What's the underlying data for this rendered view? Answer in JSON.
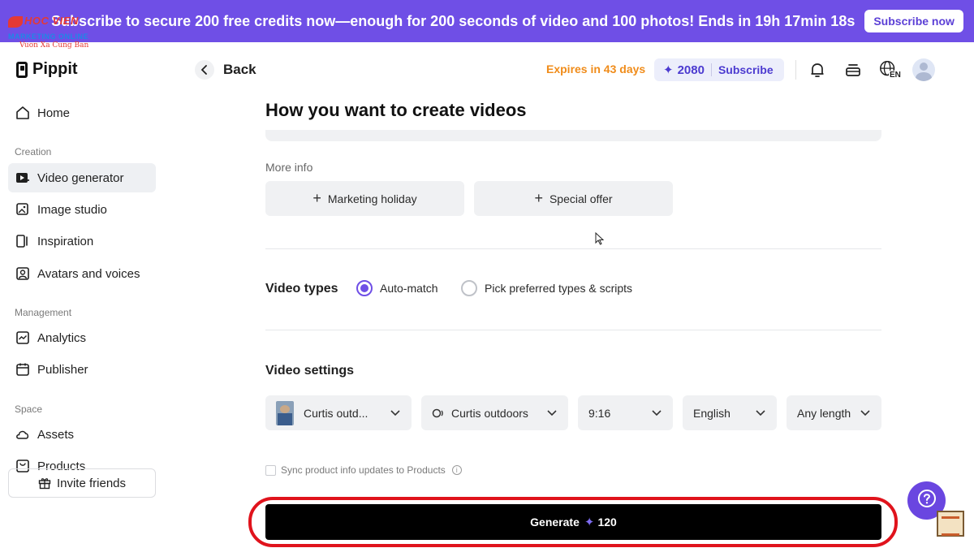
{
  "promo": {
    "text": "Subscribe to secure 200 free credits now—enough for 200 seconds of video and 100 photos! Ends in 19h 17min 18s",
    "button": "Subscribe now"
  },
  "watermark": {
    "top": "HOC VIEN",
    "middle": "MARKETING ONLINE",
    "bottom": "Vuon Xa Cung Ban"
  },
  "brand": {
    "name": "Pippit"
  },
  "sidebar": {
    "home": "Home",
    "section_creation": "Creation",
    "creation_items": [
      "Video generator",
      "Image studio",
      "Inspiration",
      "Avatars and voices"
    ],
    "section_management": "Management",
    "management_items": [
      "Analytics",
      "Publisher"
    ],
    "section_space": "Space",
    "space_items": [
      "Assets",
      "Products"
    ],
    "invite": "Invite friends",
    "active_item": "Video generator"
  },
  "header": {
    "back": "Back",
    "expires": "Expires in 43 days",
    "credits": "2080",
    "subscribe": "Subscribe",
    "language": "EN"
  },
  "main": {
    "title": "How you want to create videos",
    "more_info_label": "More info",
    "chips": [
      "Marketing holiday",
      "Special offer"
    ],
    "video_types_label": "Video types",
    "video_type_options": [
      "Auto-match",
      "Pick preferred types & scripts"
    ],
    "video_type_selected": "Auto-match",
    "video_settings_label": "Video settings",
    "settings": {
      "avatar": "Curtis outd...",
      "voice": "Curtis outdoors",
      "aspect_ratio": "9:16",
      "language": "English",
      "length": "Any length"
    },
    "sync_label": "Sync product info updates to Products",
    "sync_checked": false,
    "generate_label": "Generate",
    "generate_cost": "120"
  },
  "colors": {
    "accent": "#6f4fe6",
    "expires": "#f08c1a",
    "highlight_ring": "#e0131c"
  },
  "icons": [
    "home-icon",
    "video-generator-icon",
    "image-studio-icon",
    "inspiration-icon",
    "avatar-icon",
    "analytics-icon",
    "publisher-icon",
    "assets-icon",
    "products-icon",
    "gift-icon",
    "bell-icon",
    "layers-icon",
    "globe-icon",
    "help-icon"
  ]
}
